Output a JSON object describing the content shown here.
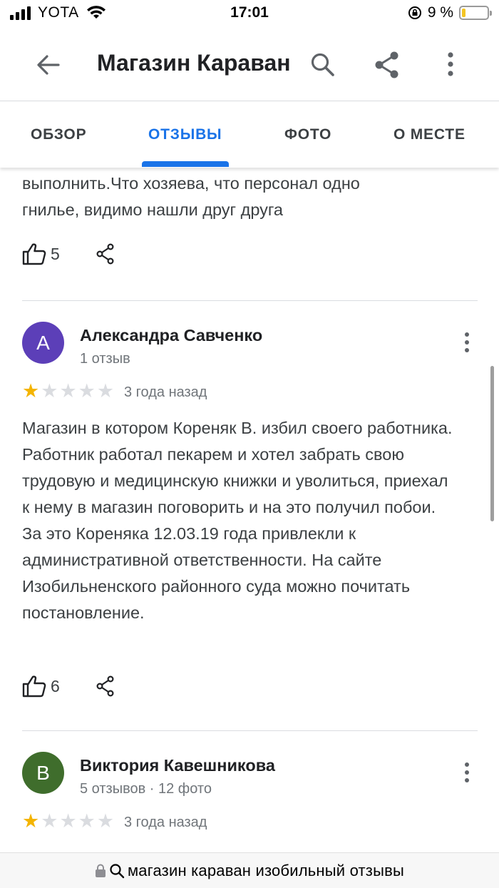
{
  "status_bar": {
    "carrier": "YOTA",
    "time": "17:01",
    "battery_percent": "9 %",
    "battery_level": 0.09,
    "signal_icon": "signal-bars-icon",
    "wifi_icon": "wifi-icon",
    "rotation_lock_icon": "rotation-lock-icon"
  },
  "app_bar": {
    "title": "Магазин Караван",
    "back_icon": "arrow-left-icon",
    "search_icon": "search-icon",
    "share_icon": "share-icon",
    "more_icon": "more-vert-icon"
  },
  "tabs": [
    {
      "label": "ОБЗОР",
      "active": false
    },
    {
      "label": "ОТЗЫВЫ",
      "active": true
    },
    {
      "label": "ФОТО",
      "active": false
    },
    {
      "label": "О МЕСТЕ",
      "active": false
    }
  ],
  "colors": {
    "accent": "#1a73e8",
    "star_filled": "#f4b400",
    "star_empty": "#dadce0",
    "avatar_a": "#5c3fb8",
    "avatar_b": "#3f6d2c"
  },
  "reviews_partial": {
    "text_line_1": "выполнить.Что хозяева, что персонал одно",
    "text_line_2": "гнилье, видимо нашли друг друга",
    "likes": "5"
  },
  "reviews": [
    {
      "initial": "А",
      "author": "Александра Савченко",
      "meta": "1 отзыв",
      "rating": 1,
      "max_rating": 5,
      "when": "3 года назад",
      "text": "Магазин в котором Кореняк В. избил своего работника. Работник работал пекарем и хотел забрать свою трудовую и медицинскую книжки и уволиться, приехал к нему в магазин поговорить и на это получил побои. За это Кореняка 12.03.19 года привлекли к административной ответственности. На сайте Изобильненского районного суда можно почитать постановление.",
      "likes": "6"
    },
    {
      "initial": "В",
      "author": "Виктория Кавешникова",
      "meta": "5 отзывов · 12 фото",
      "rating": 1,
      "max_rating": 5,
      "when": "3 года назад"
    }
  ],
  "url_bar": {
    "lock_icon": "lock-icon",
    "search_icon": "search-icon",
    "text": "магазин караван изобильный отзывы"
  }
}
